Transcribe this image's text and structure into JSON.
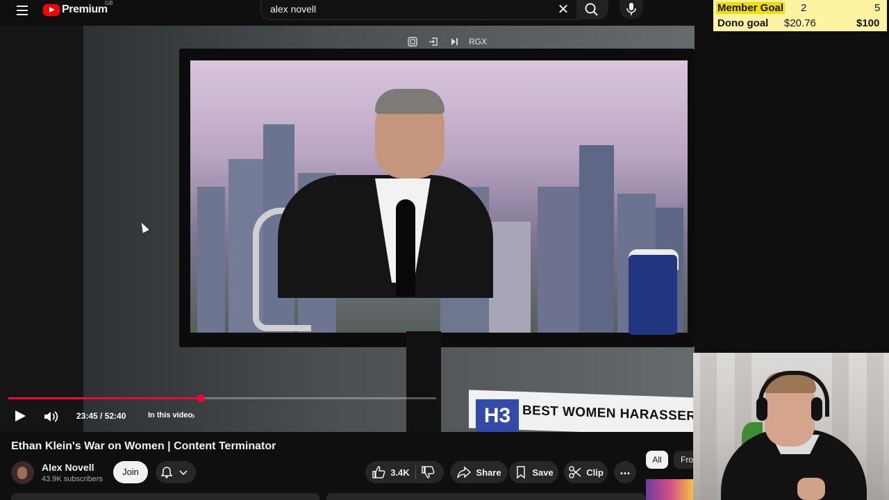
{
  "header": {
    "logo_text": "Premium",
    "region": "GB",
    "search_value": "alex novell"
  },
  "goals": {
    "member_label": "Member Goal",
    "member_current": "2",
    "member_target": "5",
    "dono_label": "Dono goal",
    "dono_current": "$20.76",
    "dono_target": "$100"
  },
  "player": {
    "overlay_label": "RGX",
    "time": "23:45 / 52:40",
    "progress_fraction": 0.4508,
    "in_this_video": "In this video"
  },
  "video_frame": {
    "sign_h3": "H3",
    "sign_text": "BEST WOMEN HARASSER"
  },
  "video": {
    "title": "Ethan Klein's War on Women | Content Terminator",
    "channel": "Alex Novell",
    "subscribers": "43.9K subscribers",
    "join_label": "Join",
    "likes": "3.4K",
    "share_label": "Share",
    "save_label": "Save",
    "clip_label": "Clip",
    "more_label": "..."
  },
  "chips": {
    "all": "All",
    "from": "Fro"
  },
  "colors": {
    "brand_red": "#ff0000",
    "progress_red": "#ff0033",
    "goal_yellow": "#f2dd00"
  }
}
